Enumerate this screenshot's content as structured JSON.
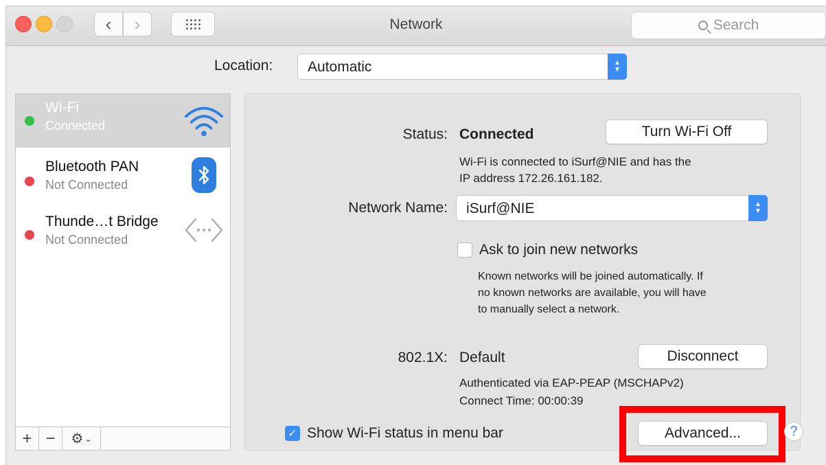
{
  "window": {
    "title": "Network",
    "search_placeholder": "Search"
  },
  "location": {
    "label": "Location:",
    "value": "Automatic"
  },
  "sidebar": {
    "services": [
      {
        "name": "Wi-Fi",
        "status": "Connected",
        "dot_color": "#36c04a",
        "icon": "wifi-icon",
        "selected": true
      },
      {
        "name": "Bluetooth PAN",
        "status": "Not Connected",
        "dot_color": "#e5484d",
        "icon": "bluetooth-icon"
      },
      {
        "name": "Thunde…t Bridge",
        "status": "Not Connected",
        "dot_color": "#e5484d",
        "icon": "thunderbolt-bridge-icon"
      }
    ],
    "toolbar": {
      "add": "+",
      "remove": "−"
    }
  },
  "detail": {
    "status_label": "Status:",
    "status_value": "Connected",
    "turn_off_button": "Turn Wi-Fi Off",
    "status_desc_1": "Wi-Fi is connected to iSurf@NIE and has the",
    "status_desc_2": "IP address 172.26.161.182.",
    "network_name_label": "Network Name:",
    "network_name_value": "iSurf@NIE",
    "ask_join_label": "Ask to join new networks",
    "ask_join_desc_1": "Known networks will be joined automatically. If",
    "ask_join_desc_2": "no known networks are available, you will have",
    "ask_join_desc_3": "to manually select a network.",
    "dot1x_label": "802.1X:",
    "dot1x_value": "Default",
    "disconnect_button": "Disconnect",
    "auth_desc": "Authenticated via EAP-PEAP (MSCHAPv2)",
    "connect_time": "Connect Time: 00:00:39"
  },
  "footer": {
    "show_status_label": "Show Wi-Fi status in menu bar",
    "advanced_button": "Advanced...",
    "help": "?"
  },
  "colors": {
    "accent": "#3b8cf5",
    "highlight": "#ff0000"
  }
}
